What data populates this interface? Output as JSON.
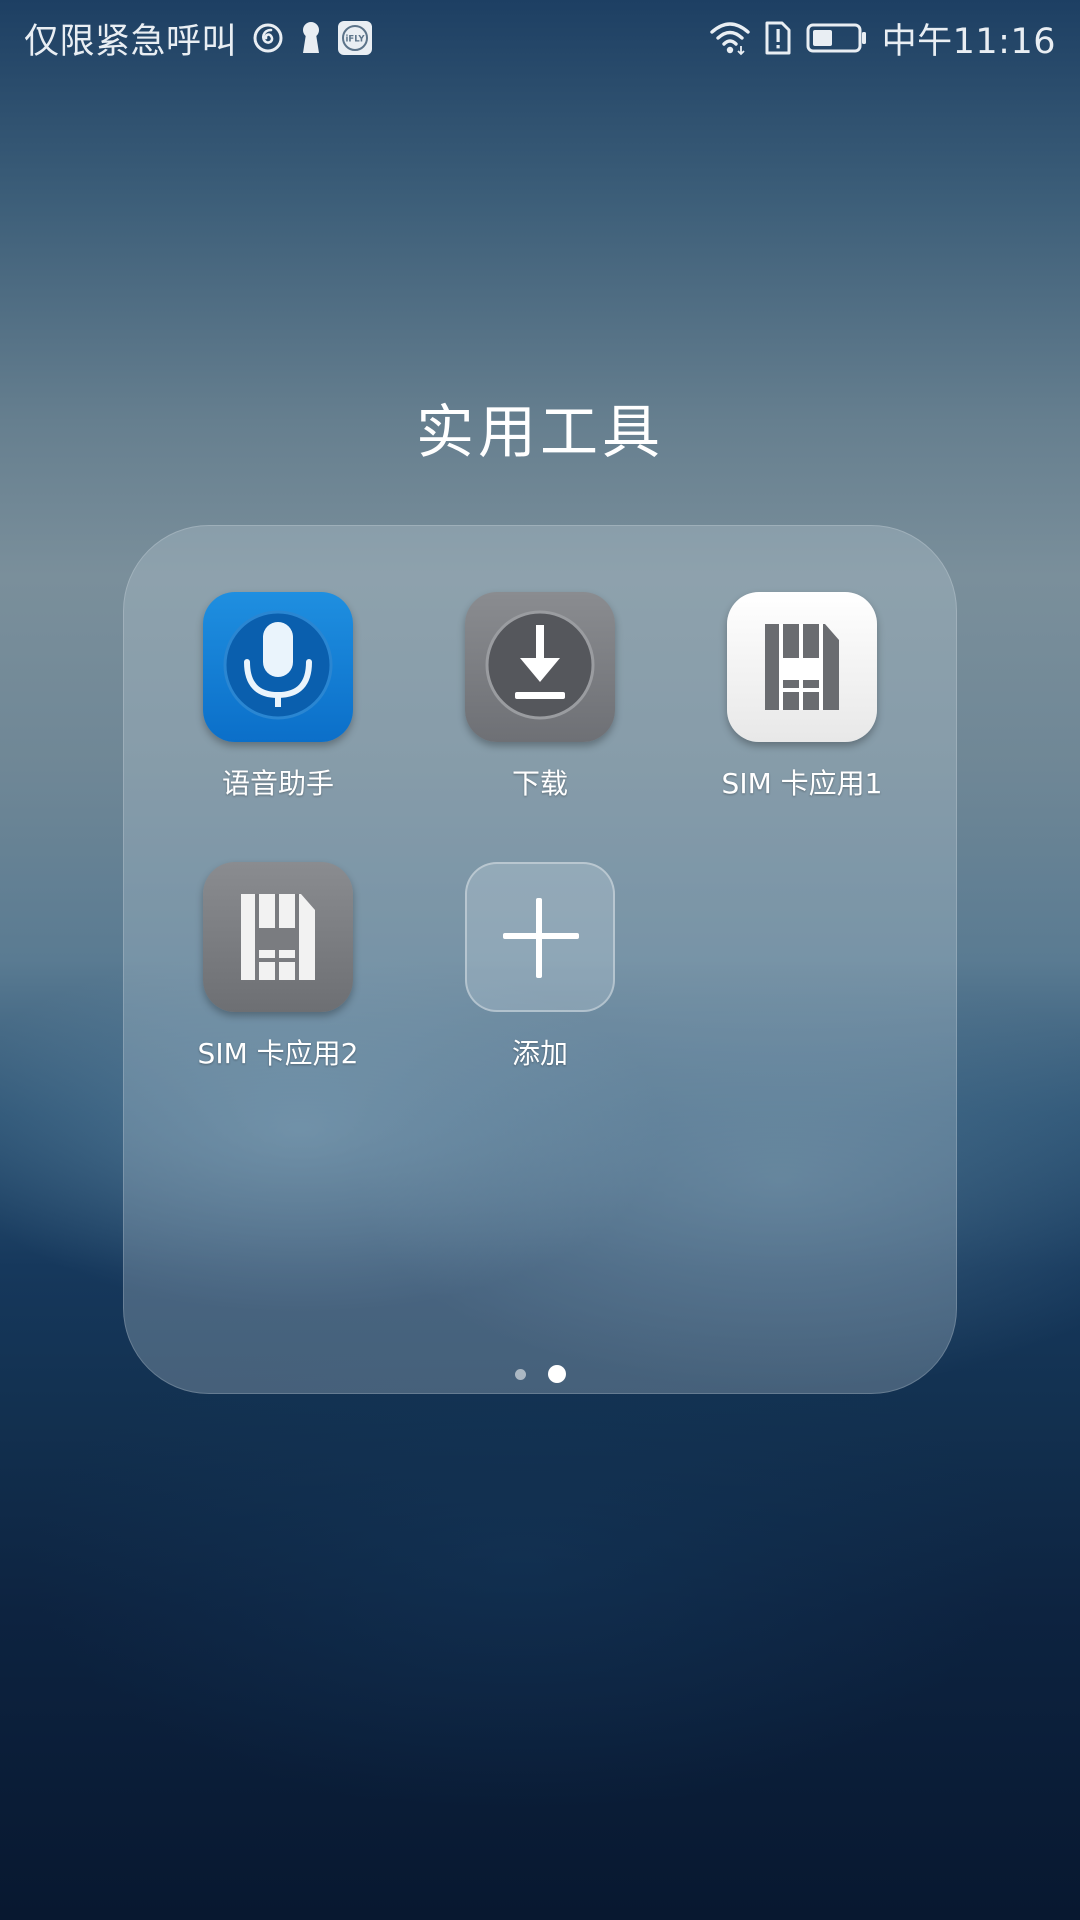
{
  "status_bar": {
    "carrier_text": "仅限紧急呼叫",
    "left_icons": [
      "netease-music-icon",
      "keyhole-icon",
      "ifly-icon"
    ],
    "ifly_badge_text": "iFLY",
    "right_icons": [
      "wifi-icon",
      "sim-alert-icon",
      "battery-icon"
    ],
    "time": "中午11:16"
  },
  "folder": {
    "title": "实用工具",
    "apps": [
      {
        "label": "语音助手",
        "icon": "microphone-icon"
      },
      {
        "label": "下载",
        "icon": "download-icon"
      },
      {
        "label": "SIM 卡应用1",
        "icon": "sim-card-icon"
      },
      {
        "label": "SIM 卡应用2",
        "icon": "sim-card-icon"
      },
      {
        "label": "添加",
        "icon": "plus-icon"
      }
    ],
    "pages": {
      "count": 2,
      "current": 2
    }
  },
  "colors": {
    "voice_assistant_blue": "#0b6fc9",
    "icon_gray": "#7a7c80",
    "icon_white": "#f4f4f4",
    "text": "#ffffff"
  }
}
